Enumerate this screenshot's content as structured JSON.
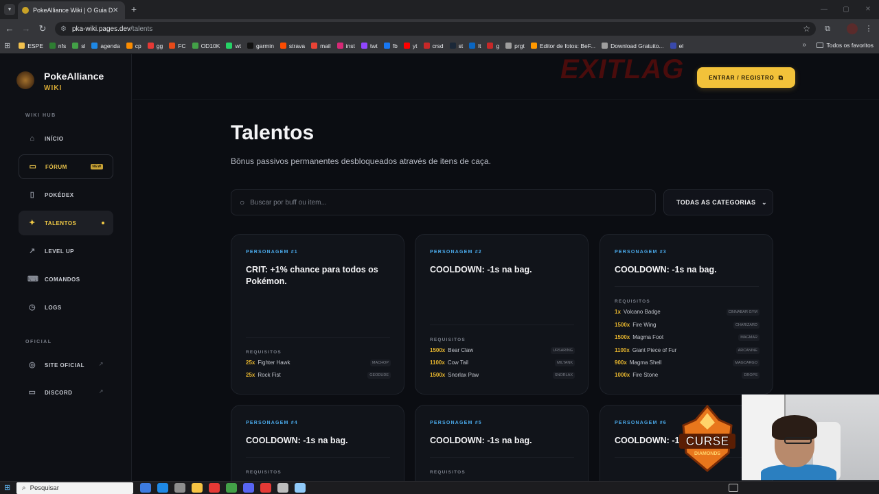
{
  "browser": {
    "tab_title": "PokeAlliance Wiki | O Guia Def",
    "url_host": "pka-wiki.pages.dev",
    "url_path": "/talents",
    "bookmarks": [
      {
        "label": "ESPE",
        "color": "#f2c14e"
      },
      {
        "label": "nfs",
        "color": "#2e7d32"
      },
      {
        "label": "sl",
        "color": "#43a047"
      },
      {
        "label": "agenda",
        "color": "#1e88e5"
      },
      {
        "label": "cp",
        "color": "#fb8c00"
      },
      {
        "label": "gg",
        "color": "#e53935"
      },
      {
        "label": "FC",
        "color": "#e64a19"
      },
      {
        "label": "OD10K",
        "color": "#43a047"
      },
      {
        "label": "wt",
        "color": "#25d366"
      },
      {
        "label": "garmin",
        "color": "#111111"
      },
      {
        "label": "strava",
        "color": "#fc4c02"
      },
      {
        "label": "mail",
        "color": "#ea4335"
      },
      {
        "label": "inst",
        "color": "#d62976"
      },
      {
        "label": "twt",
        "color": "#9146ff"
      },
      {
        "label": "fb",
        "color": "#1877f2"
      },
      {
        "label": "yt",
        "color": "#ff0000"
      },
      {
        "label": "crsd",
        "color": "#c62828"
      },
      {
        "label": "st",
        "color": "#1b2838"
      },
      {
        "label": "lt",
        "color": "#0a66c2"
      },
      {
        "label": "g",
        "color": "#c62828"
      },
      {
        "label": "prgt",
        "color": "#9e9e9e"
      },
      {
        "label": "Editor de fotos: BeF...",
        "color": "#ff9800"
      },
      {
        "label": "Download Gratuito...",
        "color": "#9e9e9e"
      },
      {
        "label": "el",
        "color": "#3949ab"
      }
    ],
    "favorites_label": "Todos os favoritos"
  },
  "sidebar": {
    "brand_title": "PokeAlliance",
    "brand_sub": "WIKI",
    "section_hub": "WIKI HUB",
    "section_official": "OFICIAL",
    "items": [
      {
        "label": "INÍCIO",
        "icon": "home-icon"
      },
      {
        "label": "FÓRUM",
        "icon": "chat-icon",
        "badge": "NEW"
      },
      {
        "label": "POKÉDEX",
        "icon": "book-icon"
      },
      {
        "label": "TALENTOS",
        "icon": "sparkle-icon",
        "active": true
      },
      {
        "label": "LEVEL UP",
        "icon": "trend-icon"
      },
      {
        "label": "COMANDOS",
        "icon": "keyboard-icon"
      },
      {
        "label": "LOGS",
        "icon": "clock-icon"
      }
    ],
    "official_items": [
      {
        "label": "SITE OFICIAL",
        "icon": "globe-icon"
      },
      {
        "label": "DISCORD",
        "icon": "discord-icon"
      }
    ]
  },
  "header": {
    "watermark": "EXITLAG",
    "login_label": "ENTRAR / REGISTRO"
  },
  "page": {
    "title": "Talentos",
    "subtitle": "Bônus passivos permanentes desbloqueados através de itens de caça.",
    "search_placeholder": "Buscar por buff ou item...",
    "category_selected": "TODAS AS CATEGORIAS"
  },
  "cards": [
    {
      "id": "PERSONAGEM #1",
      "title": "CRIT: +1% chance para todos os Pokémon.",
      "req_label": "REQUISITOS",
      "requirements": [
        {
          "qty": "25x",
          "item": "Fighter Hawk",
          "pokemon": "MACHOP"
        },
        {
          "qty": "25x",
          "item": "Rock Fist",
          "pokemon": "GEODUDE"
        }
      ]
    },
    {
      "id": "PERSONAGEM #2",
      "title": "COOLDOWN: -1s na bag.",
      "req_label": "REQUISITOS",
      "requirements": [
        {
          "qty": "1500x",
          "item": "Bear Claw",
          "pokemon": "URSARING"
        },
        {
          "qty": "1100x",
          "item": "Cow Tail",
          "pokemon": "MILTANK"
        },
        {
          "qty": "1500x",
          "item": "Snorlax Paw",
          "pokemon": "SNORLAX"
        }
      ]
    },
    {
      "id": "PERSONAGEM #3",
      "title": "COOLDOWN: -1s na bag.",
      "req_label": "REQUISITOS",
      "requirements": [
        {
          "qty": "1x",
          "item": "Volcano Badge",
          "pokemon": "CINNABAR GYM"
        },
        {
          "qty": "1500x",
          "item": "Fire Wing",
          "pokemon": "CHARIZARD"
        },
        {
          "qty": "1500x",
          "item": "Magma Foot",
          "pokemon": "MAGMAR"
        },
        {
          "qty": "1100x",
          "item": "Giant Piece of Fur",
          "pokemon": "ARCANINE"
        },
        {
          "qty": "900x",
          "item": "Magma Shell",
          "pokemon": "MAGCARGO"
        },
        {
          "qty": "1000x",
          "item": "Fire Stone",
          "pokemon": "DROPS"
        }
      ]
    },
    {
      "id": "PERSONAGEM #4",
      "title": "COOLDOWN: -1s na bag.",
      "req_label": "REQUISITOS"
    },
    {
      "id": "PERSONAGEM #5",
      "title": "COOLDOWN: -1s na bag.",
      "req_label": "REQUISITOS"
    },
    {
      "id": "PERSONAGEM #6",
      "title": "COOLDOWN: -1s na bag.",
      "req_label": "REQUISITOS"
    }
  ],
  "overlay": {
    "logo_text": "CURSE",
    "logo_sub": "DIAMONDS"
  },
  "taskbar": {
    "search_label": "Pesquisar",
    "icons": [
      "#3d7be0",
      "#1e88e5",
      "#8e8e8e",
      "#f6c343",
      "#e53935",
      "#43a047",
      "#5865f2",
      "#e53935",
      "#bdbdbd",
      "#90caf9"
    ]
  },
  "colors": {
    "accent": "#f2c23a",
    "card_id": "#4aa8e8",
    "background": "#0b0d12"
  }
}
